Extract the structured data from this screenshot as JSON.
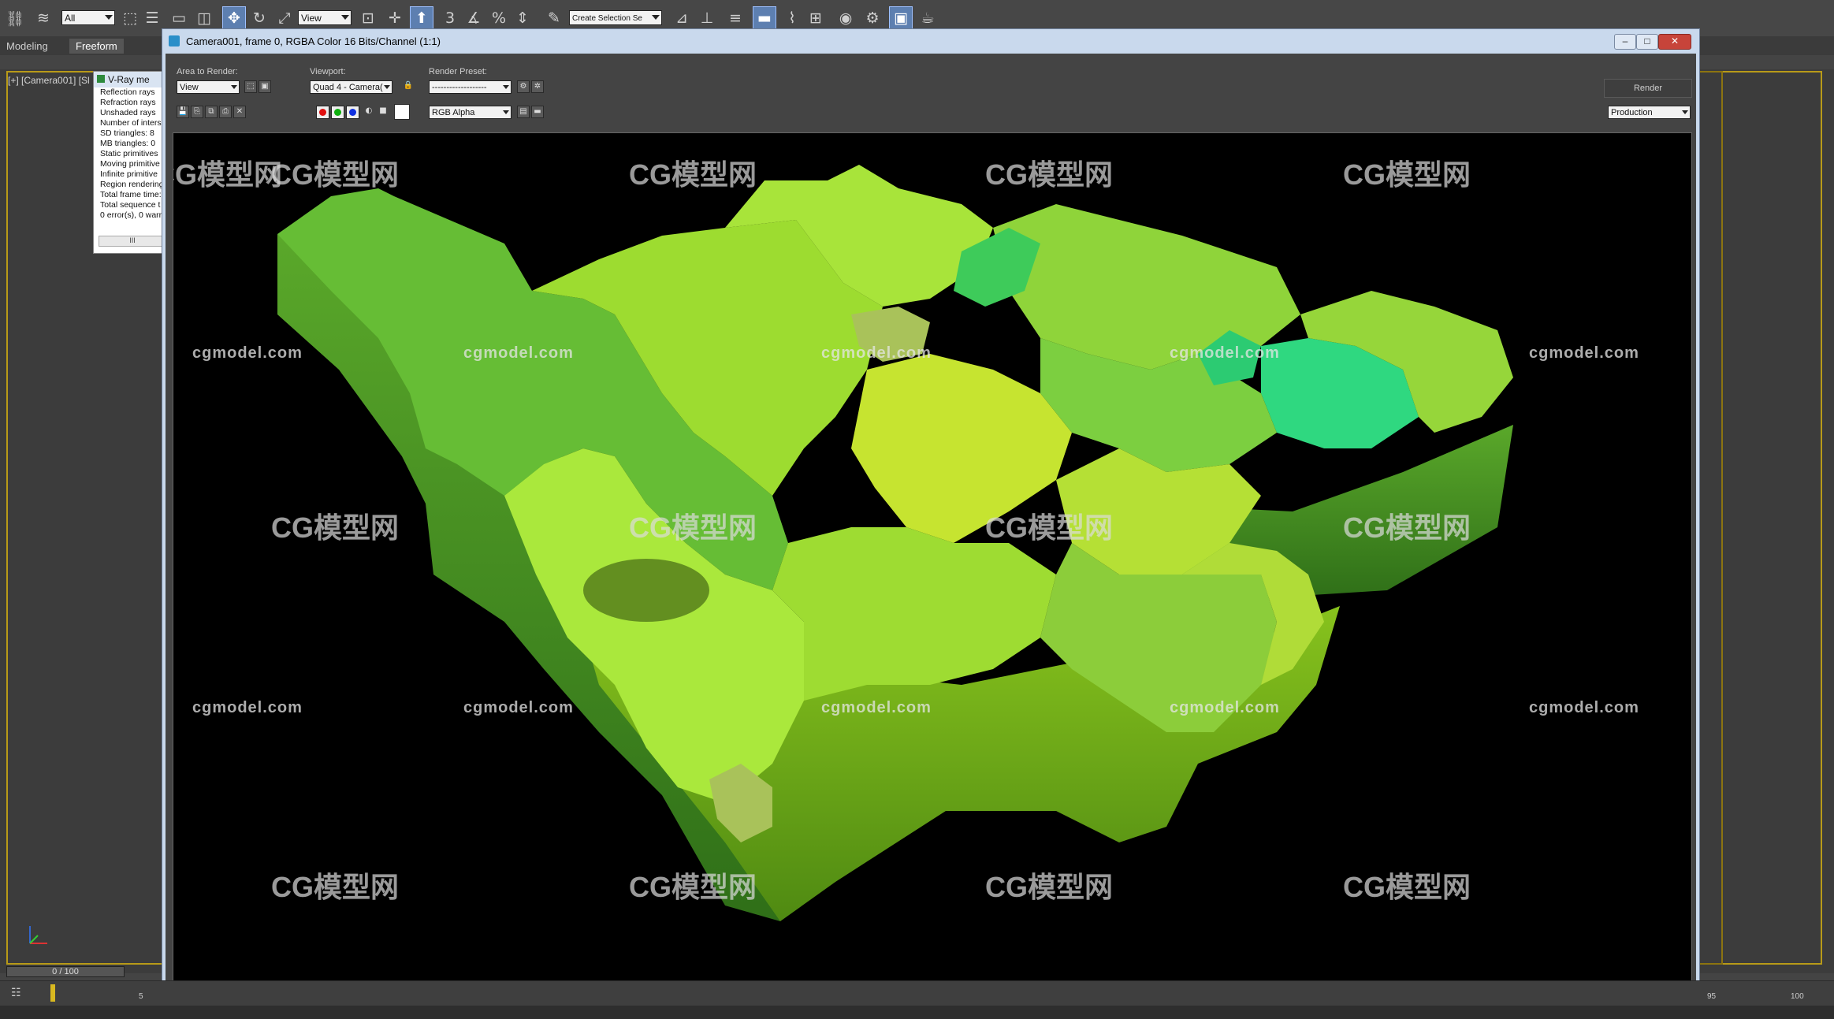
{
  "toolbar": {
    "selection_filter": "All",
    "ref_coord": "View",
    "selection_set": "Create Selection Se",
    "snap_angle": "3",
    "percent_snap": "%"
  },
  "ribbon": {
    "tabs": [
      "Modeling",
      "Freeform"
    ]
  },
  "viewport": {
    "label": "[+] [Camera001] [Sl"
  },
  "vray_messages": {
    "title": "V-Ray me",
    "lines": [
      "Reflection rays",
      "Refraction rays",
      "Unshaded rays",
      "Number of inters",
      "SD triangles: 8",
      "MB triangles: 0",
      "Static primitives",
      "Moving primitive",
      "Infinite primitive",
      "Region rendering",
      "Total frame time:",
      "Total sequence t",
      "0 error(s), 0 warn"
    ],
    "scroll_label": "III"
  },
  "render_window": {
    "title": "Camera001, frame 0, RGBA Color 16 Bits/Channel (1:1)",
    "area_to_render_label": "Area to Render:",
    "area_to_render_value": "View",
    "viewport_label": "Viewport:",
    "viewport_value": "Quad 4 - Camera(",
    "render_preset_label": "Render Preset:",
    "render_preset_value": "-------------------",
    "render_button": "Render",
    "render_mode": "Production",
    "channel_display": "RGB Alpha",
    "minimize": "–",
    "maximize": "□",
    "close": "✕"
  },
  "watermarks": {
    "site": "cgmodel.com",
    "brand": "模型网",
    "brand_prefix": "CG"
  },
  "timeline": {
    "slider_text": "0 / 100",
    "ticks": [
      "5",
      "95",
      "100"
    ]
  },
  "colors": {
    "selection_highlight": "#5d7fb0",
    "viewport_border": "#b89a18",
    "red_channel": "#e01010",
    "green_channel": "#10b010",
    "blue_channel": "#1030e0"
  }
}
